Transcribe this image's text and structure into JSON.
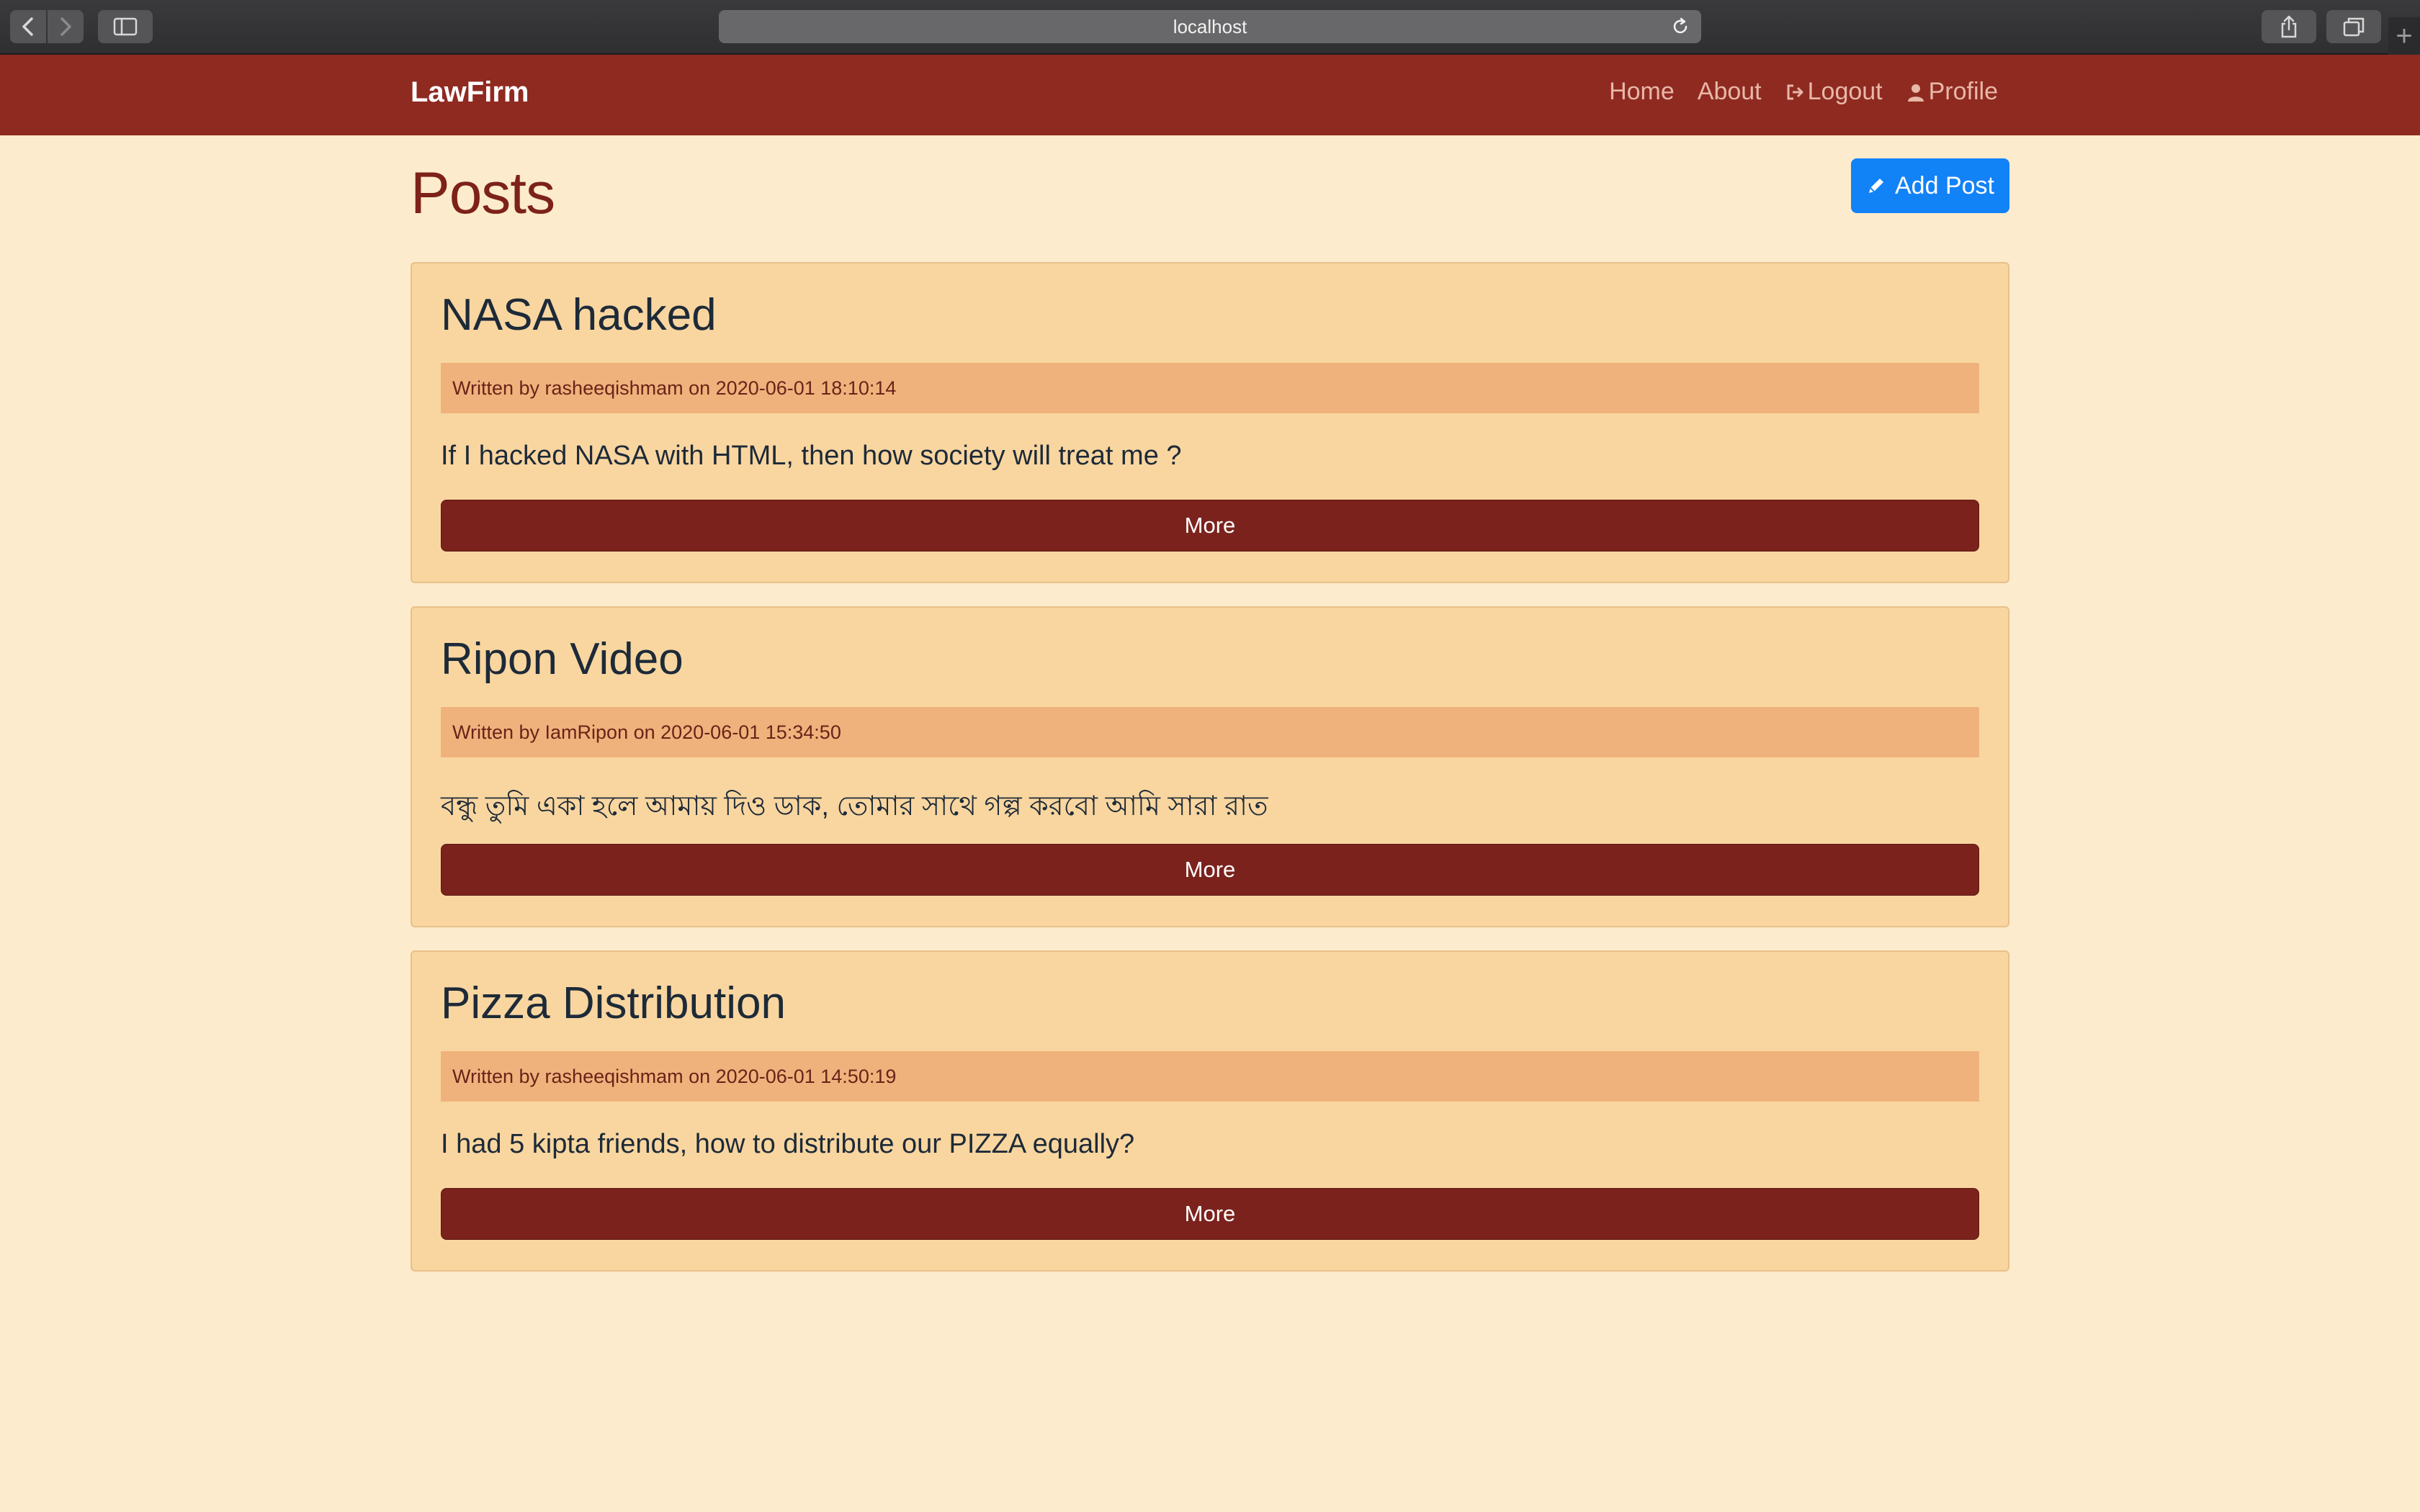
{
  "browser": {
    "url": "localhost"
  },
  "navbar": {
    "brand": "LawFirm",
    "links": [
      {
        "label": "Home"
      },
      {
        "label": "About"
      },
      {
        "label": "Logout",
        "icon": "sign-out-icon"
      },
      {
        "label": "Profile",
        "icon": "user-icon"
      }
    ]
  },
  "page": {
    "title": "Posts",
    "add_post_label": "Add Post"
  },
  "posts": [
    {
      "title": "NASA hacked",
      "meta": "Written by rasheeqishmam on 2020-06-01 18:10:14",
      "body": "If I hacked NASA with HTML, then how society will treat me ?",
      "button": "More"
    },
    {
      "title": "Ripon Video",
      "meta": "Written by IamRipon on 2020-06-01 15:34:50",
      "body": "বন্ধু তুমি একা হলে আমায় দিও ডাক, তোমার সাথে গল্প করবো আমি সারা রাত",
      "button": "More"
    },
    {
      "title": "Pizza Distribution",
      "meta": "Written by rasheeqishmam on 2020-06-01 14:50:19",
      "body": "I had 5 kipta friends, how to distribute our PIZZA equally?",
      "button": "More"
    }
  ],
  "colors": {
    "navbar": "#8f2a21",
    "page_bg": "#fdebcd",
    "card_bg": "#f9d6a0",
    "meta_bg": "#f0b27c",
    "more_button": "#7b221c",
    "add_button": "#1282f7"
  }
}
